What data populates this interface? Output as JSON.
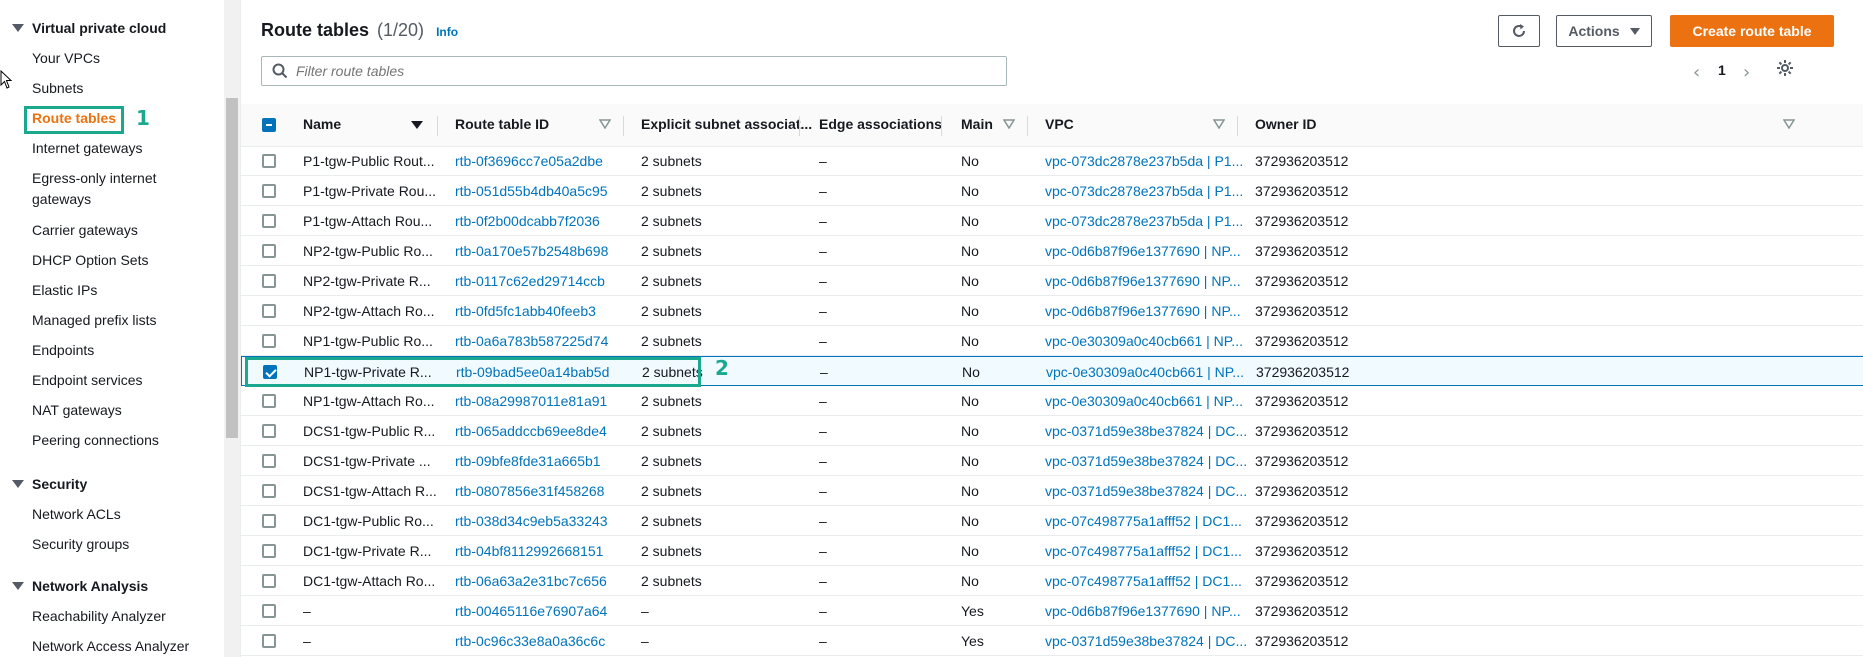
{
  "sidebar": {
    "sections": [
      {
        "label": "Virtual private cloud"
      },
      {
        "label": "Security"
      },
      {
        "label": "Network Analysis"
      }
    ],
    "vpc_items": [
      {
        "label": "Your VPCs"
      },
      {
        "label": "Subnets"
      },
      {
        "label": "Route tables"
      },
      {
        "label": "Internet gateways"
      },
      {
        "label": "Egress-only internet gateways"
      },
      {
        "label": "Carrier gateways"
      },
      {
        "label": "DHCP Option Sets"
      },
      {
        "label": "Elastic IPs"
      },
      {
        "label": "Managed prefix lists"
      },
      {
        "label": "Endpoints"
      },
      {
        "label": "Endpoint services"
      },
      {
        "label": "NAT gateways"
      },
      {
        "label": "Peering connections"
      }
    ],
    "security_items": [
      {
        "label": "Network ACLs"
      },
      {
        "label": "Security groups"
      }
    ],
    "analysis_items": [
      {
        "label": "Reachability Analyzer"
      },
      {
        "label": "Network Access Analyzer"
      }
    ],
    "active_item": "Route tables"
  },
  "annotations": {
    "step1": "1",
    "step2": "2"
  },
  "header": {
    "title": "Route tables",
    "count": "(1/20)",
    "info": "Info",
    "actions_label": "Actions",
    "create_label": "Create route table"
  },
  "filter": {
    "placeholder": "Filter route tables"
  },
  "pagination": {
    "page": "1",
    "prev": "‹",
    "next": "›"
  },
  "columns": {
    "name": "Name",
    "route_table_id": "Route table ID",
    "explicit": "Explicit subnet associat...",
    "edge": "Edge associations",
    "main": "Main",
    "vpc": "VPC",
    "owner": "Owner ID"
  },
  "rows": [
    {
      "name": "P1-tgw-Public Rout...",
      "id": "rtb-0f3696cc7e05a2dbe",
      "explicit": "2 subnets",
      "edge": "–",
      "main": "No",
      "vpc": "vpc-073dc2878e237b5da | P1...",
      "owner": "372936203512",
      "checked": false
    },
    {
      "name": "P1-tgw-Private Rou...",
      "id": "rtb-051d55b4db40a5c95",
      "explicit": "2 subnets",
      "edge": "–",
      "main": "No",
      "vpc": "vpc-073dc2878e237b5da | P1...",
      "owner": "372936203512",
      "checked": false
    },
    {
      "name": "P1-tgw-Attach Rou...",
      "id": "rtb-0f2b00dcabb7f2036",
      "explicit": "2 subnets",
      "edge": "–",
      "main": "No",
      "vpc": "vpc-073dc2878e237b5da | P1...",
      "owner": "372936203512",
      "checked": false
    },
    {
      "name": "NP2-tgw-Public Ro...",
      "id": "rtb-0a170e57b2548b698",
      "explicit": "2 subnets",
      "edge": "–",
      "main": "No",
      "vpc": "vpc-0d6b87f96e1377690 | NP...",
      "owner": "372936203512",
      "checked": false
    },
    {
      "name": "NP2-tgw-Private R...",
      "id": "rtb-0117c62ed29714ccb",
      "explicit": "2 subnets",
      "edge": "–",
      "main": "No",
      "vpc": "vpc-0d6b87f96e1377690 | NP...",
      "owner": "372936203512",
      "checked": false
    },
    {
      "name": "NP2-tgw-Attach Ro...",
      "id": "rtb-0fd5fc1abb40feeb3",
      "explicit": "2 subnets",
      "edge": "–",
      "main": "No",
      "vpc": "vpc-0d6b87f96e1377690 | NP...",
      "owner": "372936203512",
      "checked": false
    },
    {
      "name": "NP1-tgw-Public Ro...",
      "id": "rtb-0a6a783b587225d74",
      "explicit": "2 subnets",
      "edge": "–",
      "main": "No",
      "vpc": "vpc-0e30309a0c40cb661 | NP...",
      "owner": "372936203512",
      "checked": false
    },
    {
      "name": "NP1-tgw-Private R...",
      "id": "rtb-09bad5ee0a14bab5d",
      "explicit": "2 subnets",
      "edge": "–",
      "main": "No",
      "vpc": "vpc-0e30309a0c40cb661 | NP...",
      "owner": "372936203512",
      "checked": true
    },
    {
      "name": "NP1-tgw-Attach Ro...",
      "id": "rtb-08a29987011e81a91",
      "explicit": "2 subnets",
      "edge": "–",
      "main": "No",
      "vpc": "vpc-0e30309a0c40cb661 | NP...",
      "owner": "372936203512",
      "checked": false
    },
    {
      "name": "DCS1-tgw-Public R...",
      "id": "rtb-065addccb69ee8de4",
      "explicit": "2 subnets",
      "edge": "–",
      "main": "No",
      "vpc": "vpc-0371d59e38be37824 | DC...",
      "owner": "372936203512",
      "checked": false
    },
    {
      "name": "DCS1-tgw-Private ...",
      "id": "rtb-09bfe8fde31a665b1",
      "explicit": "2 subnets",
      "edge": "–",
      "main": "No",
      "vpc": "vpc-0371d59e38be37824 | DC...",
      "owner": "372936203512",
      "checked": false
    },
    {
      "name": "DCS1-tgw-Attach R...",
      "id": "rtb-0807856e31f458268",
      "explicit": "2 subnets",
      "edge": "–",
      "main": "No",
      "vpc": "vpc-0371d59e38be37824 | DC...",
      "owner": "372936203512",
      "checked": false
    },
    {
      "name": "DC1-tgw-Public Ro...",
      "id": "rtb-038d34c9eb5a33243",
      "explicit": "2 subnets",
      "edge": "–",
      "main": "No",
      "vpc": "vpc-07c498775a1afff52 | DC1...",
      "owner": "372936203512",
      "checked": false
    },
    {
      "name": "DC1-tgw-Private R...",
      "id": "rtb-04bf8112992668151",
      "explicit": "2 subnets",
      "edge": "–",
      "main": "No",
      "vpc": "vpc-07c498775a1afff52 | DC1...",
      "owner": "372936203512",
      "checked": false
    },
    {
      "name": "DC1-tgw-Attach Ro...",
      "id": "rtb-06a63a2e31bc7c656",
      "explicit": "2 subnets",
      "edge": "–",
      "main": "No",
      "vpc": "vpc-07c498775a1afff52 | DC1...",
      "owner": "372936203512",
      "checked": false
    },
    {
      "name": "–",
      "id": "rtb-00465116e76907a64",
      "explicit": "–",
      "edge": "–",
      "main": "Yes",
      "vpc": "vpc-0d6b87f96e1377690 | NP...",
      "owner": "372936203512",
      "checked": false
    },
    {
      "name": "–",
      "id": "rtb-0c96c33e8a0a36c6c",
      "explicit": "–",
      "edge": "–",
      "main": "Yes",
      "vpc": "vpc-0371d59e38be37824 | DC...",
      "owner": "372936203512",
      "checked": false
    }
  ],
  "colors": {
    "accent": "#ec7211",
    "link": "#0073bb",
    "highlight": "#1aa98f"
  }
}
